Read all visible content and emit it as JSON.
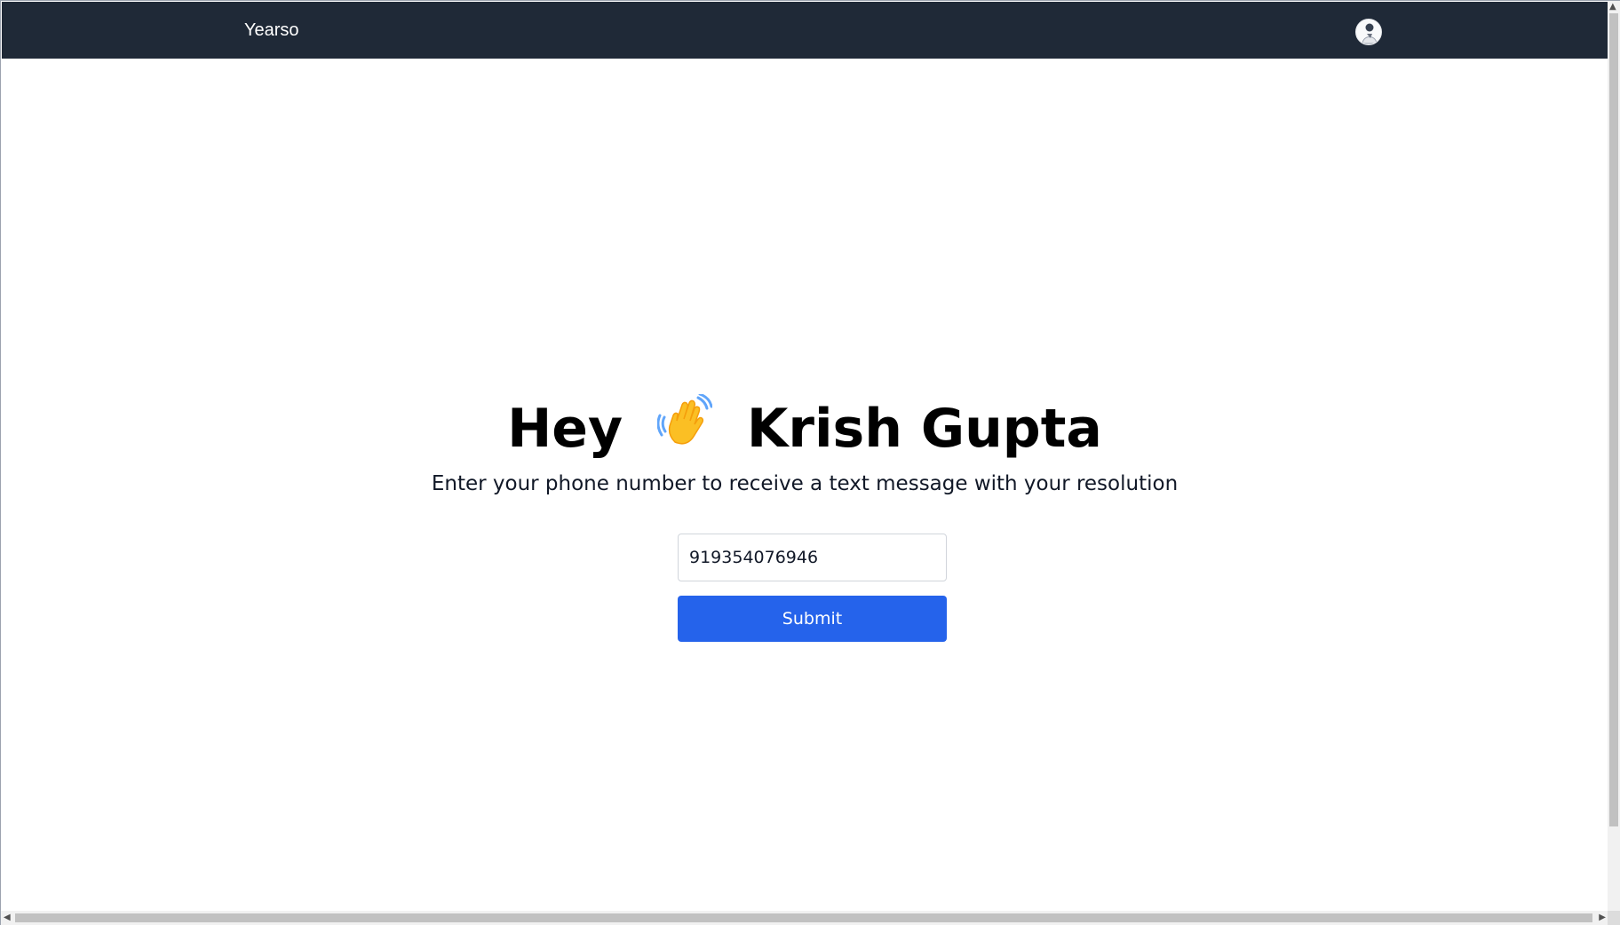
{
  "navbar": {
    "brand": "Yearso",
    "avatar_icon": "user-avatar-icon"
  },
  "main": {
    "greeting_prefix": "Hey",
    "wave_icon": "waving-hand-icon",
    "user_name": "Krish Gupta",
    "subtitle": "Enter your phone number to receive a text message with your resolution"
  },
  "form": {
    "phone_value": "919354076946",
    "submit_label": "Submit"
  },
  "colors": {
    "navbar_bg": "#1f2937",
    "button_bg": "#2563eb",
    "wave_yellow": "#fbbf24",
    "wave_lines": "#60a5fa"
  }
}
